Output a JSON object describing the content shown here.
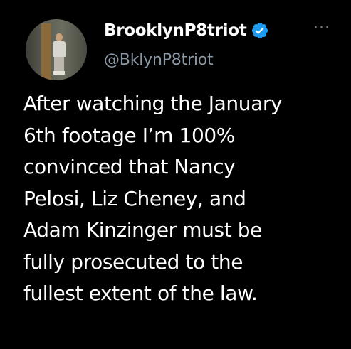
{
  "tweet": {
    "display_name": "BrooklynP8triot",
    "handle": "@BklynP8triot",
    "more_label": "···",
    "verified": true,
    "verified_color": "#1d9bf0",
    "avatar_icon": "profile-photo",
    "body_lines": [
      "After watching the January",
      "6th footage I’m 100%",
      "convinced that Nancy",
      "Pelosi, Liz Cheney, and",
      "Adam Kinzinger must be",
      "fully prosecuted to the",
      "fullest extent of the law."
    ]
  }
}
